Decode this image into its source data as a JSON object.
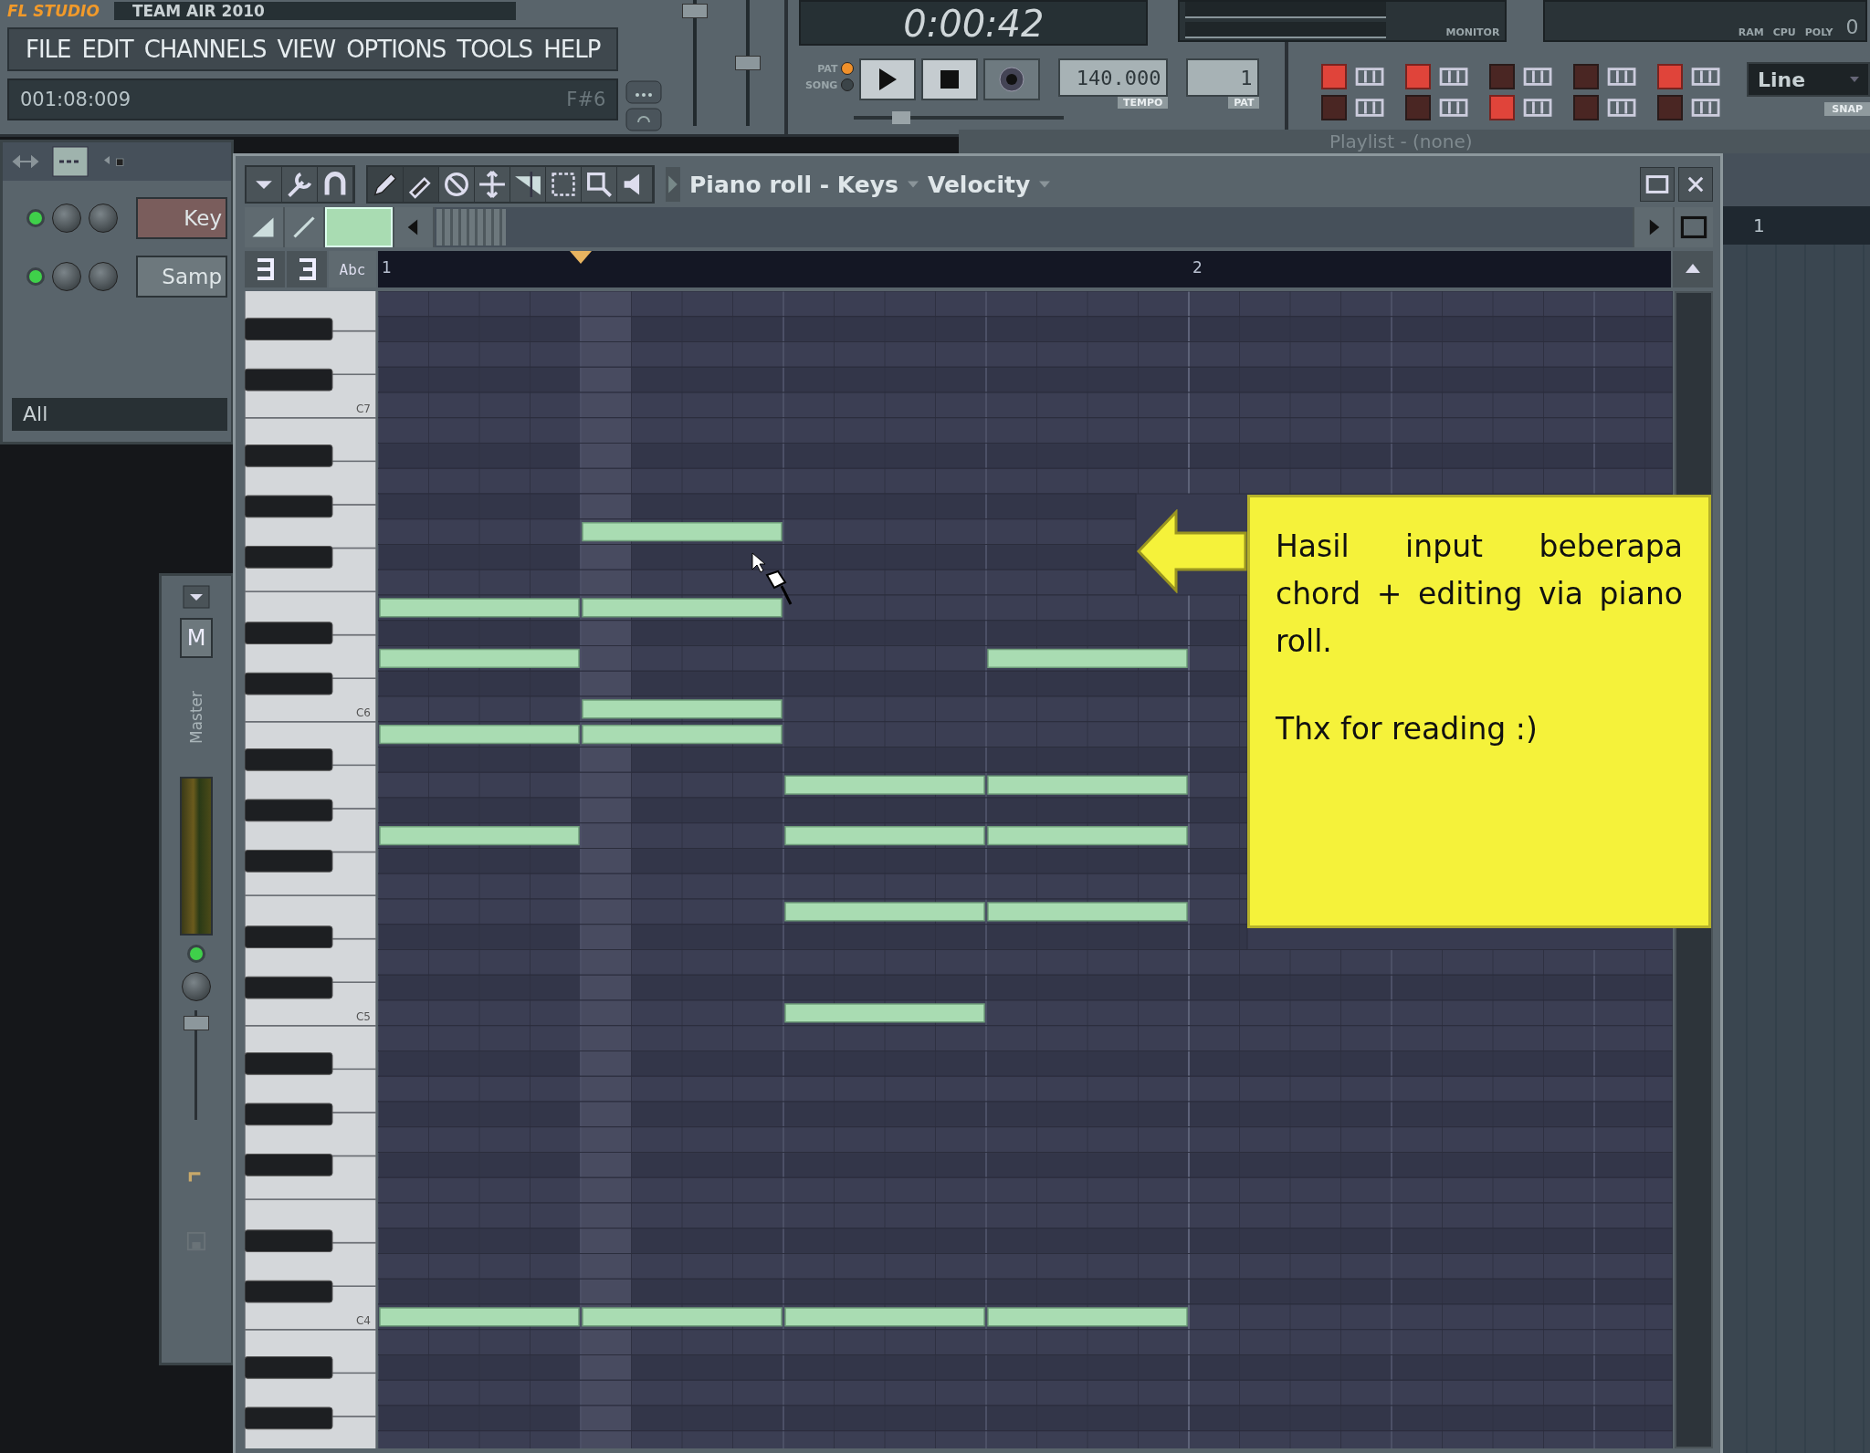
{
  "app": {
    "logo": "FL STUDIO",
    "project_title": "TEAM AIR 2010"
  },
  "menu": [
    "FILE",
    "EDIT",
    "CHANNELS",
    "VIEW",
    "OPTIONS",
    "TOOLS",
    "HELP"
  ],
  "hint_bar": {
    "position": "001:08:009",
    "note": "F#6"
  },
  "master_sliders": [
    {
      "level": 0.97
    },
    {
      "level": 0.5
    }
  ],
  "transport": {
    "time": "0:00:42",
    "modes": [
      {
        "label": "PAT",
        "selected": true
      },
      {
        "label": "SONG",
        "selected": false
      }
    ],
    "tempo": "140.000",
    "tempo_label": "TEMPO",
    "pattern": "1",
    "pattern_label": "PAT",
    "monitor_label": "MONITOR",
    "position": {
      "level": 0.2
    }
  },
  "stats": {
    "ram_label": "RAM",
    "cpu_label": "CPU",
    "poly_label": "POLY",
    "poly": "0"
  },
  "toggles": [
    {
      "on": true
    },
    {
      "on": false
    },
    {
      "on": true
    },
    {
      "on": false
    },
    {
      "on": false
    },
    {
      "on": true
    },
    {
      "on": false
    },
    {
      "on": false
    },
    {
      "on": true
    },
    {
      "on": false
    }
  ],
  "snap": {
    "value": "Line",
    "label": "SNAP"
  },
  "channel_rack": {
    "channels": [
      {
        "name": "Key",
        "selected": true,
        "on": true
      },
      {
        "name": "Samp",
        "selected": false,
        "on": true
      }
    ],
    "filter": "All"
  },
  "mixer": {
    "mute_label": "M",
    "track": "Master"
  },
  "playlist": {
    "title": "Playlist - (none)",
    "bar_labels": [
      "1"
    ]
  },
  "piano_roll": {
    "title": "Piano roll - Keys",
    "target": "Velocity",
    "text_button": "Abc",
    "timeline_labels": [
      "1",
      "2"
    ],
    "key_labels": [
      "C7",
      "C6",
      "C5",
      "C4"
    ],
    "rows": [
      {
        "beats": [
          false,
          false,
          false,
          false
        ]
      },
      {
        "beats": [
          false,
          false,
          false,
          false
        ]
      },
      {
        "beats": [
          false,
          false,
          false,
          false
        ]
      },
      {
        "beats": [
          false,
          false,
          false,
          false
        ]
      },
      {
        "beats": [
          false,
          false,
          false,
          false
        ]
      },
      {
        "beats": [
          false,
          false,
          false,
          false
        ]
      },
      {
        "beats": [
          false,
          false,
          false,
          false
        ]
      },
      {
        "beats": [
          false,
          false,
          false,
          false
        ]
      },
      {
        "beats": [
          false,
          false,
          false,
          false
        ]
      },
      {
        "beats": [
          false,
          true,
          false,
          false
        ]
      },
      {
        "beats": [
          false,
          false,
          false,
          false
        ]
      },
      {
        "beats": [
          false,
          false,
          false,
          false
        ]
      },
      {
        "beats": [
          true,
          true,
          false,
          false
        ]
      },
      {
        "beats": [
          false,
          false,
          false,
          false
        ]
      },
      {
        "beats": [
          true,
          false,
          false,
          true
        ]
      },
      {
        "beats": [
          false,
          false,
          false,
          false
        ]
      },
      {
        "beats": [
          false,
          true,
          false,
          false
        ]
      },
      {
        "beats": [
          true,
          true,
          false,
          false
        ]
      },
      {
        "beats": [
          false,
          false,
          false,
          false
        ]
      },
      {
        "beats": [
          false,
          false,
          true,
          true
        ]
      },
      {
        "beats": [
          false,
          false,
          false,
          false
        ]
      },
      {
        "beats": [
          true,
          false,
          true,
          true
        ]
      },
      {
        "beats": [
          false,
          false,
          false,
          false
        ]
      },
      {
        "beats": [
          false,
          false,
          false,
          false
        ]
      },
      {
        "beats": [
          false,
          false,
          true,
          true
        ]
      },
      {
        "beats": [
          false,
          false,
          false,
          false
        ]
      },
      {
        "beats": [
          false,
          false,
          false,
          false
        ]
      },
      {
        "beats": [
          false,
          false,
          false,
          false
        ]
      },
      {
        "beats": [
          false,
          false,
          true,
          false
        ]
      },
      {
        "beats": [
          false,
          false,
          false,
          false
        ]
      },
      {
        "beats": [
          false,
          false,
          false,
          false
        ]
      },
      {
        "beats": [
          false,
          false,
          false,
          false
        ]
      },
      {
        "beats": [
          false,
          false,
          false,
          false
        ]
      },
      {
        "beats": [
          false,
          false,
          false,
          false
        ]
      },
      {
        "beats": [
          false,
          false,
          false,
          false
        ]
      },
      {
        "beats": [
          false,
          false,
          false,
          false
        ]
      },
      {
        "beats": [
          false,
          false,
          false,
          false
        ]
      },
      {
        "beats": [
          false,
          false,
          false,
          false
        ]
      },
      {
        "beats": [
          false,
          false,
          false,
          false
        ]
      },
      {
        "beats": [
          false,
          false,
          false,
          false
        ]
      },
      {
        "beats": [
          true,
          true,
          true,
          true
        ]
      },
      {
        "beats": [
          false,
          false,
          false,
          false
        ]
      },
      {
        "beats": [
          false,
          false,
          false,
          false
        ]
      },
      {
        "beats": [
          false,
          false,
          false,
          false
        ]
      },
      {
        "beats": [
          false,
          false,
          false,
          false
        ]
      },
      {
        "beats": [
          false,
          false,
          false,
          false
        ]
      }
    ]
  },
  "sticky_note": {
    "paragraphs": [
      "Hasil input beberapa chord + editing via piano roll.",
      "Thx for reading :)"
    ]
  }
}
